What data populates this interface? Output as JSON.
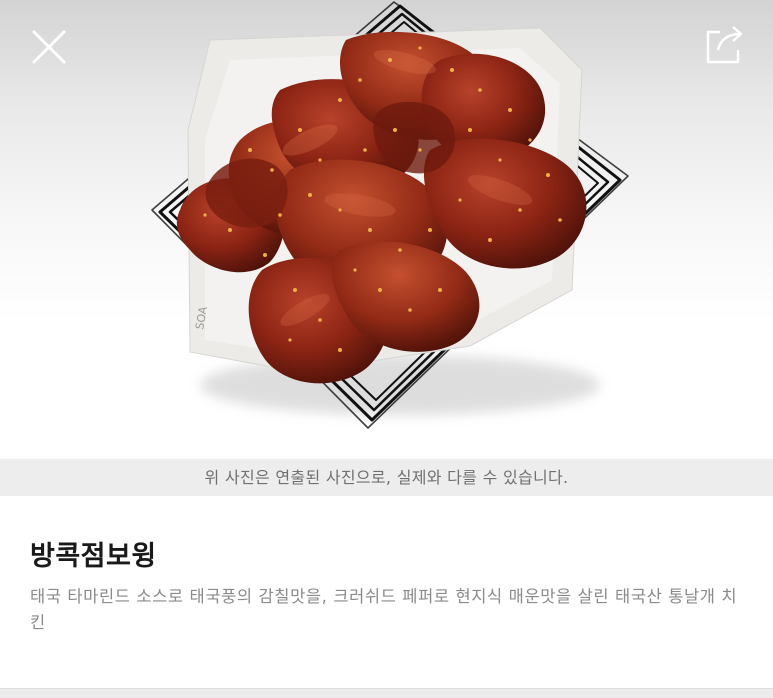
{
  "header": {
    "close_icon": "close-icon",
    "share_icon": "share-icon"
  },
  "hero": {
    "image": "wings-basket-photo"
  },
  "notice": {
    "text": "위 사진은 연출된 사진으로, 실제와 다를 수 있습니다."
  },
  "product": {
    "name": "방콕점보윙",
    "description": "태국 타마린드 소스로 태국풍의 감칠맛을, 크러쉬드 페퍼로 현지식 매운맛을 살린 태국산 통날개 치킨"
  },
  "colors": {
    "notice_bg": "#ededed",
    "notice_text": "#707070",
    "title_text": "#1a1a1a",
    "desc_text": "#8a8a8a",
    "sauce_red": "#8c2414"
  }
}
